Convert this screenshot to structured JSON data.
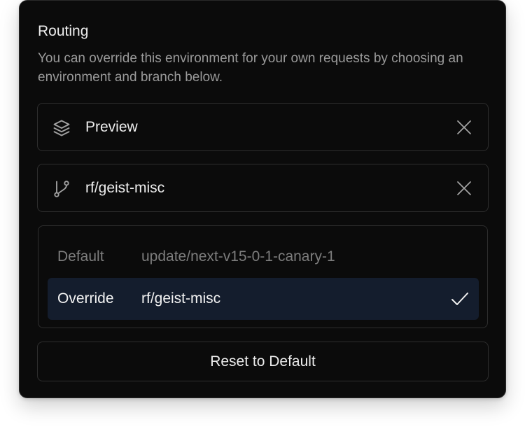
{
  "routing": {
    "title": "Routing",
    "description": "You can override this environment for your own requests by choosing an environment and branch below."
  },
  "environment_field": {
    "icon": "layers-icon",
    "value": "Preview",
    "clear_icon": "close-icon"
  },
  "branch_field": {
    "icon": "git-branch-icon",
    "value": "rf/geist-misc",
    "clear_icon": "close-icon"
  },
  "routes": [
    {
      "label": "Default",
      "branch": "update/next-v15-0-1-canary-1",
      "selected": false
    },
    {
      "label": "Override",
      "branch": "rf/geist-misc",
      "selected": true,
      "indicator_icon": "check-icon"
    }
  ],
  "reset_button": {
    "label": "Reset to Default"
  },
  "colors": {
    "panel_bg": "#0b0b0b",
    "border": "#2e2e2e",
    "text_primary": "#ededed",
    "text_muted": "#9a9a9a",
    "selected_row_bg": "#141d2d"
  }
}
